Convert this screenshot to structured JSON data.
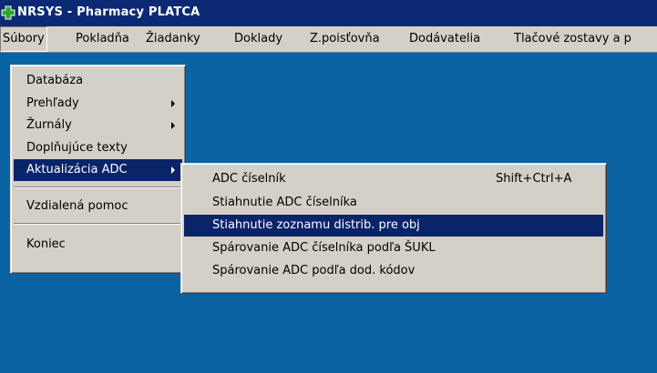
{
  "window": {
    "title": "NRSYS - Pharmacy  PLATCA",
    "icon": "app-cross-icon"
  },
  "menubar": {
    "items": [
      {
        "label": "Súbory"
      },
      {
        "label": "Pokladňa"
      },
      {
        "label": "Žiadanky"
      },
      {
        "label": "Doklady"
      },
      {
        "label": "Z.poisťovňa"
      },
      {
        "label": "Dodávatelia"
      },
      {
        "label": "Tlačové zostavy a p"
      }
    ]
  },
  "file_menu": {
    "items": [
      {
        "label": "Databáza"
      },
      {
        "label": "Prehľady",
        "submenu_icon": "chevron-right-icon"
      },
      {
        "label": "Žurnály",
        "submenu_icon": "chevron-right-icon"
      },
      {
        "label": "Doplňujúce texty"
      },
      {
        "label": "Aktualizácia ADC",
        "submenu_icon": "chevron-right-icon",
        "selected": true
      },
      {
        "label": "Vzdialená pomoc"
      },
      {
        "label": "Koniec"
      }
    ]
  },
  "adc_submenu": {
    "items": [
      {
        "label": "ADC číselník",
        "shortcut": "Shift+Ctrl+A"
      },
      {
        "label": "Stiahnutie ADC číselníka"
      },
      {
        "label": "Stiahnutie zoznamu distrib. pre obj",
        "selected": true
      },
      {
        "label": "Spárovanie ADC číselníka podľa ŠUKL"
      },
      {
        "label": "Spárovanie ADC podľa dod. kódov"
      }
    ]
  },
  "colors": {
    "desktop": "#0a64a4",
    "titlebar": "#0b2a73",
    "menu_face": "#d4d0c8",
    "highlight": "#0a246a",
    "app_icon": "#2aa82a"
  }
}
